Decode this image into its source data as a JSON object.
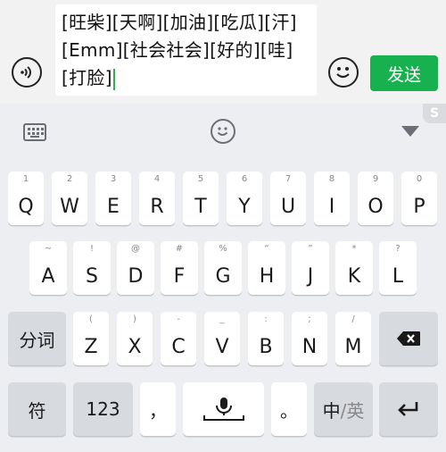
{
  "composer": {
    "text": "[旺柴][天啊][加油][吃瓜][汗][Emm][社会社会][好的][哇][打脸]",
    "send_label": "发送"
  },
  "keyboard": {
    "row1": [
      {
        "main": "Q",
        "sub": "1"
      },
      {
        "main": "W",
        "sub": "2"
      },
      {
        "main": "E",
        "sub": "3"
      },
      {
        "main": "R",
        "sub": "4"
      },
      {
        "main": "T",
        "sub": "5"
      },
      {
        "main": "Y",
        "sub": "6"
      },
      {
        "main": "U",
        "sub": "7"
      },
      {
        "main": "I",
        "sub": "8"
      },
      {
        "main": "O",
        "sub": "9"
      },
      {
        "main": "P",
        "sub": "0"
      }
    ],
    "row2": [
      {
        "main": "A",
        "sub": "~"
      },
      {
        "main": "S",
        "sub": "!"
      },
      {
        "main": "D",
        "sub": "@"
      },
      {
        "main": "F",
        "sub": "#"
      },
      {
        "main": "G",
        "sub": "%"
      },
      {
        "main": "H",
        "sub": "“"
      },
      {
        "main": "J",
        "sub": "”"
      },
      {
        "main": "K",
        "sub": "*"
      },
      {
        "main": "L",
        "sub": "?"
      }
    ],
    "row3": [
      {
        "main": "Z",
        "sub": "("
      },
      {
        "main": "X",
        "sub": ")"
      },
      {
        "main": "C",
        "sub": "-"
      },
      {
        "main": "V",
        "sub": "_"
      },
      {
        "main": "B",
        "sub": ":"
      },
      {
        "main": "N",
        "sub": ";"
      },
      {
        "main": "M",
        "sub": "/"
      }
    ],
    "segment_label": "分词",
    "symbol_label": "符",
    "numbers_label": "123",
    "comma_label": "，",
    "period_label": "。",
    "lang_primary": "中",
    "lang_secondary": "/英",
    "corner_logo": "S"
  }
}
